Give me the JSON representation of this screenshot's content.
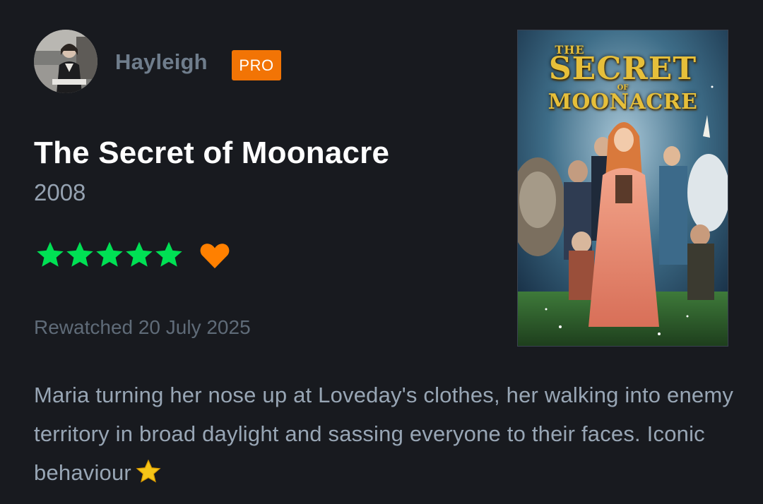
{
  "user": {
    "name": "Hayleigh",
    "badge": "PRO"
  },
  "film": {
    "title": "The Secret of Moonacre",
    "year": "2008",
    "rating_stars": 5,
    "rating_max": 5,
    "liked": true,
    "poster_title": {
      "line1": "THE",
      "line2": "SECRET",
      "line3": "OF",
      "line4": "MOONACRE"
    }
  },
  "activity": {
    "label": "Rewatched 20 July 2025"
  },
  "review": {
    "text": "Maria turning her nose up at Loveday's clothes, her walking into enemy territory in broad daylight and sassing everyone to their faces. Iconic behaviour"
  },
  "colors": {
    "background": "#181a1f",
    "star": "#00e054",
    "heart": "#ff8000",
    "pro_badge": "#f27405",
    "emoji_star": "#f5c518"
  },
  "icons": {
    "rating": "star-icon",
    "like": "heart-icon",
    "review_emoji": "star-emoji-icon"
  }
}
